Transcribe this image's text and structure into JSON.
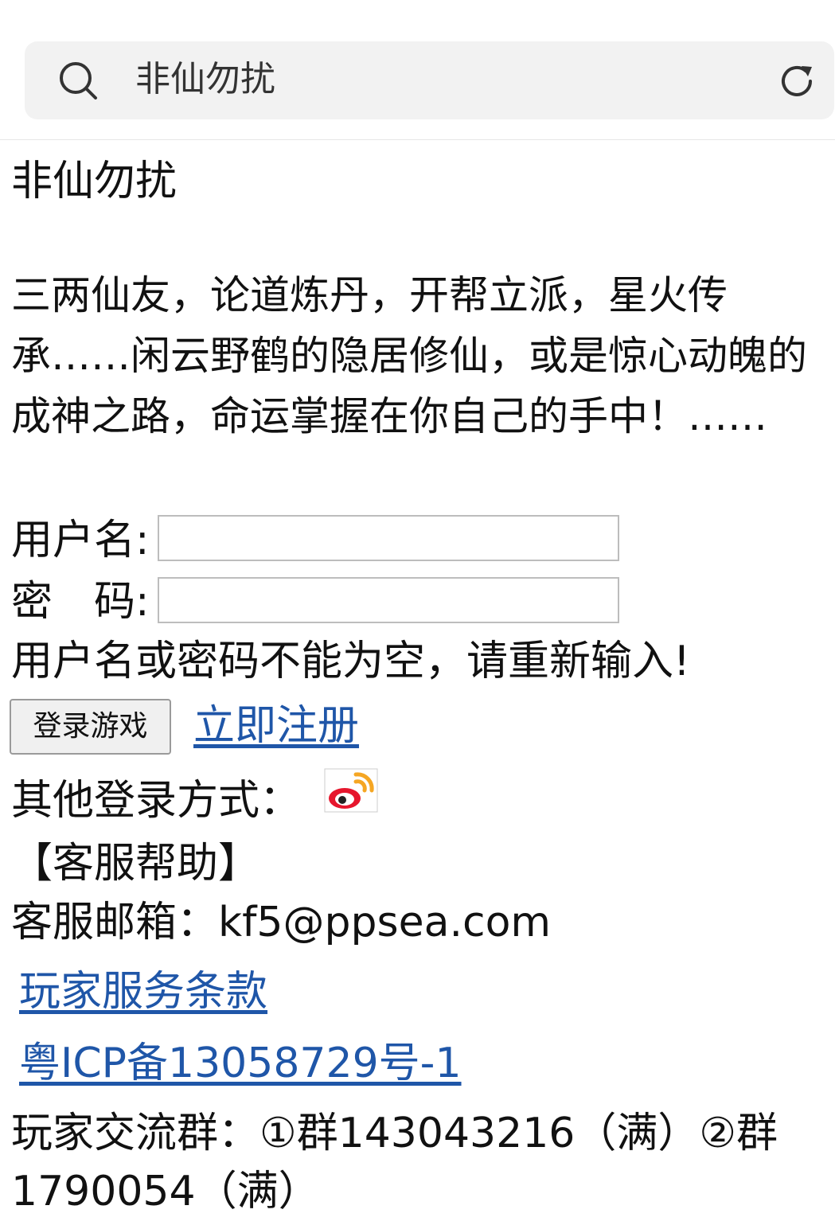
{
  "search": {
    "query": "非仙勿扰"
  },
  "page": {
    "title": "非仙勿扰",
    "description": "三两仙友，论道炼丹，开帮立派，星火传承……闲云野鹤的隐居修仙，或是惊心动魄的成神之路，命运掌握在你自己的手中！……",
    "username_label": "用户名:",
    "password_label": "密　码:",
    "error": "用户名或密码不能为空，请重新输入!",
    "login_button": "登录游戏",
    "register_link": "立即注册",
    "other_login_label": "其他登录方式：",
    "support_title": "【客服帮助】",
    "support_email": "客服邮箱：kf5@ppsea.com",
    "terms_link": "玩家服务条款",
    "icp_link": "粤ICP备13058729号-1",
    "groups_line1": "玩家交流群：①群143043216（满）②群",
    "groups_line2": "1790054（满）"
  },
  "icons": [
    "search-icon",
    "refresh-icon",
    "weibo-icon"
  ],
  "colors": {
    "link": "#1f56a8",
    "searchbox": "#f2f2f2",
    "weibo_red": "#e6162d",
    "weibo_orange": "#f5a623"
  }
}
